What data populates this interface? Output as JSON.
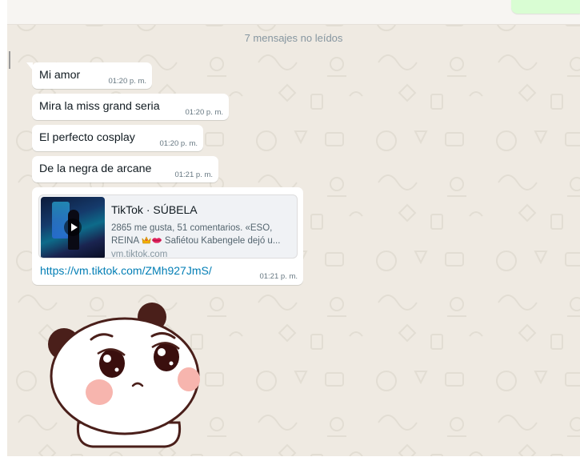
{
  "unread_divider": "7 mensajes no leídos",
  "messages": [
    {
      "text": "Mi amor",
      "time": "01:20 p. m."
    },
    {
      "text": "Mira la miss grand seria",
      "time": "01:20 p. m."
    },
    {
      "text": "El perfecto cosplay",
      "time": "01:20 p. m."
    },
    {
      "text": "De la negra de arcane",
      "time": "01:21 p. m."
    }
  ],
  "link_message": {
    "preview": {
      "title": "TikTok · SÚBELA",
      "description_line1": "2865 me gusta, 51 comentarios. «ESO,",
      "description_line2_prefix": "REINA ",
      "description_line2_suffix": " Safiétou Kabengele dejó u...",
      "domain": "vm.tiktok.com"
    },
    "url": "https://vm.tiktok.com/ZMh927JmS/",
    "time": "01:21 p. m."
  },
  "icons": {
    "play": "play-icon",
    "crown": "crown-emoji-icon",
    "lips": "kiss-lips-emoji-icon",
    "sticker": "panda-sticker"
  },
  "colors": {
    "chat_background": "#efeae2",
    "bubble_incoming": "#ffffff",
    "bubble_outgoing": "#d9fdd3",
    "link": "#027eb5",
    "timestamp": "#667781"
  }
}
